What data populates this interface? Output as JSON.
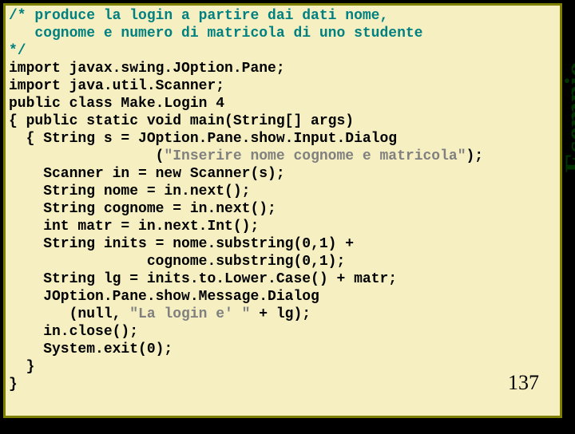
{
  "slide": {
    "side_label": "Esempio",
    "page_number": "137",
    "code": {
      "l01": "/* produce la login a partire dai dati nome,",
      "l02": "   cognome e numero di matricola di uno studente",
      "l03": "*/",
      "l04": "import javax.swing.JOption.Pane;",
      "l05": "import java.util.Scanner;",
      "l06": "public class Make.Login 4",
      "l07": "{ public static void main(String[] args)",
      "l08a": "  { String s = JOption.Pane.show.Input.Dialog",
      "l08b": "                 (",
      "l08c": "\"Inserire nome cognome e matricola\"",
      "l08d": ");",
      "l09": "    Scanner in = new Scanner(s);",
      "l10": "    String nome = in.next();",
      "l11": "    String cognome = in.next();",
      "l12": "    int matr = in.next.Int();",
      "l13": "    String inits = nome.substring(0,1) +",
      "l14": "                cognome.substring(0,1);",
      "l15": "    String lg = inits.to.Lower.Case() + matr;",
      "l16": "    JOption.Pane.show.Message.Dialog",
      "l17a": "       (null, ",
      "l17b": "\"La login e' \"",
      "l17c": " + lg);",
      "l18": "    in.close();",
      "l19": "    System.exit(0);",
      "l20": "  }",
      "l21": "}"
    }
  }
}
